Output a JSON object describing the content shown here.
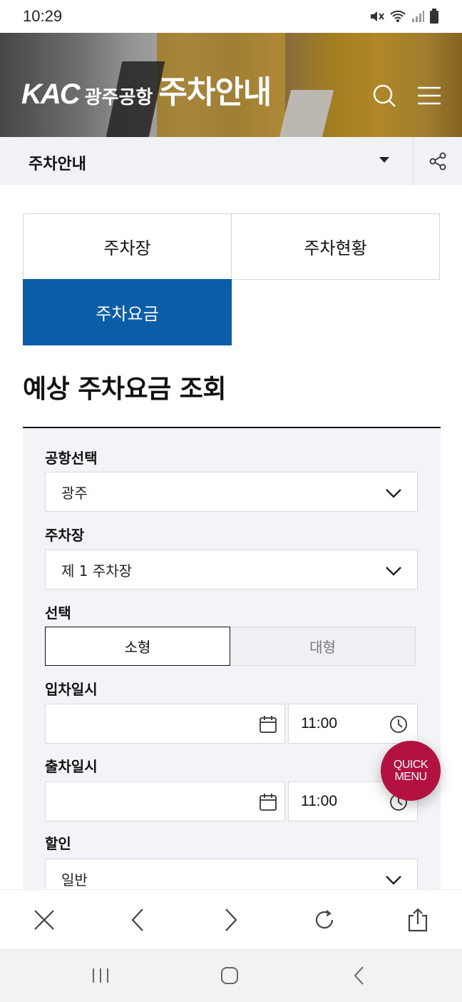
{
  "status_bar": {
    "time": "10:29"
  },
  "header": {
    "brand_logo": "KAC",
    "airport_name": "광주공항",
    "page_title": "주차안내"
  },
  "subnav": {
    "current": "주차안내"
  },
  "tabs": [
    {
      "label": "주차장",
      "active": false
    },
    {
      "label": "주차현황",
      "active": false
    },
    {
      "label": "주차요금",
      "active": true
    }
  ],
  "section_title": "예상 주차요금 조회",
  "form": {
    "airport": {
      "label": "공항선택",
      "value": "광주"
    },
    "parking_lot": {
      "label": "주차장",
      "value": "제 1 주차장"
    },
    "vehicle": {
      "label": "선택",
      "options": [
        "소형",
        "대형"
      ],
      "selected": "소형"
    },
    "entry": {
      "label": "입차일시",
      "date": "",
      "time": "11:00"
    },
    "exit": {
      "label": "출차일시",
      "date": "",
      "time": "11:00"
    },
    "discount": {
      "label": "할인",
      "value": "일반"
    }
  },
  "quick_menu": {
    "line1": "QUICK",
    "line2": "MENU"
  },
  "colors": {
    "accent": "#0a5ea8",
    "quick_menu": "#b3113f",
    "panel_bg": "#f2f4f7"
  }
}
